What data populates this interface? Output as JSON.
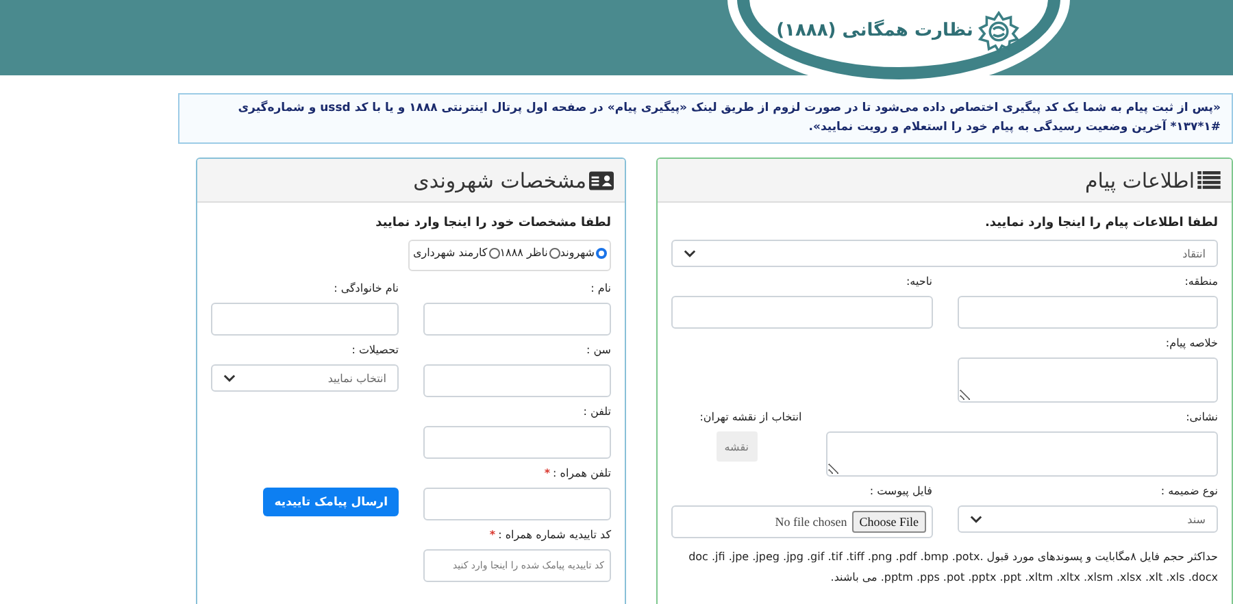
{
  "header": {
    "title": "نظارت همگانی (۱۸۸۸)"
  },
  "notice": {
    "text": "«پس از ثبت پیام به شما یک کد پیگیری اختصاص داده می‌شود تا در صورت لزوم از طریق لینک «پیگیری پیام» در صفحه اول پرتال اینترنتی ۱۸۸۸ و یا با کد ussd و شماره‌گیری #۱*۱۳۷* آخرین وضعیت رسیدگی به پیام خود را استعلام و رویت نمایید»."
  },
  "message_panel": {
    "title": "اطلاعات پیام",
    "instruction": "لطفا اطلاعات پیام را اینجا وارد نمایید.",
    "rows": [
      [
        {
          "kind": "select",
          "value": "انتقاد"
        }
      ],
      [
        {
          "kind": "input",
          "label": "منطقه:"
        },
        {
          "kind": "input",
          "label": "ناحیه:"
        }
      ],
      [
        {
          "kind": "textarea",
          "label": "خلاصه پیام:"
        }
      ],
      [
        {
          "kind": "textarea",
          "label": "نشانی:",
          "wide": true
        },
        {
          "kind": "button",
          "label": "انتخاب از نقشه تهران:",
          "text": "نقشه"
        }
      ],
      [
        {
          "kind": "select",
          "label": "نوع ضمیمه :",
          "value": "سند"
        },
        {
          "kind": "file",
          "label": "فایل پیوست :",
          "button": "Choose File",
          "status": "No file chosen"
        }
      ]
    ],
    "note": "حداکثر حجم فایل ۸مگابایت و پسوندهای مورد قبول .doc .jfi .jpe .jpeg .jpg .gif .tif .tiff .png .pdf .bmp .potx .pptm .pps .pot .pptx .ppt .xltm .xltx .xlsm .xlsx .xlt .xls .docx می باشند."
  },
  "citizen_panel": {
    "title": "مشخصات شهروندی",
    "instruction": "لطفا مشخصات خود را اینجا وارد نمایید",
    "user_types": [
      {
        "label": "شهروند",
        "selected": true
      },
      {
        "label": "ناظر ۱۸۸۸",
        "selected": false
      },
      {
        "label": "کارمند شهرداری",
        "selected": false
      }
    ],
    "rows": [
      [
        {
          "kind": "input",
          "label": "نام :"
        },
        {
          "kind": "input",
          "label": "نام خانوادگی :"
        }
      ],
      [
        {
          "kind": "input",
          "label": "سن :"
        },
        {
          "kind": "select",
          "label": "تحصیلات :",
          "value": "انتخاب نمایید"
        }
      ],
      [
        {
          "kind": "input",
          "label": "تلفن :"
        }
      ],
      [
        {
          "kind": "input",
          "label": "تلفن همراه :",
          "mark": "*"
        },
        {
          "kind": "primary",
          "text": "ارسال پیامک تاییدیه"
        }
      ],
      [
        {
          "kind": "input",
          "label": "کد تاییدیه شماره همراه :",
          "mark": "*",
          "placeholder": "کد تاییدیه پیامک شده را اینجا وارد کنید"
        }
      ]
    ]
  }
}
